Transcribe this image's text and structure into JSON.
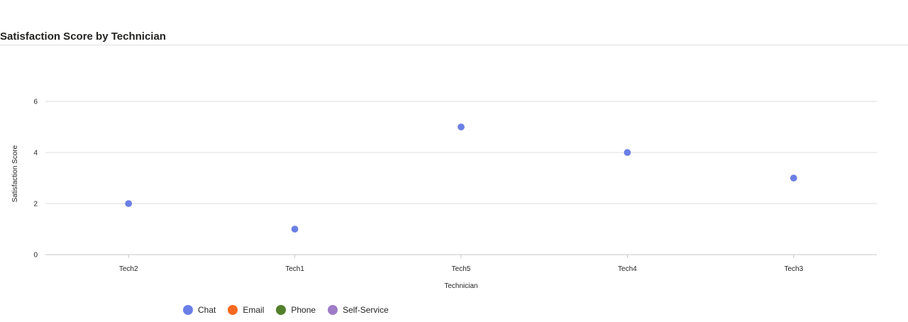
{
  "title": "Satisfaction Score by Technician",
  "chart_data": {
    "type": "scatter",
    "title": "Satisfaction Score by Technician",
    "xlabel": "Technician",
    "ylabel": "Satisfaction Score",
    "categories": [
      "Tech2",
      "Tech1",
      "Tech5",
      "Tech4",
      "Tech3"
    ],
    "ylim": [
      0,
      6
    ],
    "yticks": [
      0,
      2,
      4,
      6
    ],
    "grid": true,
    "legend_position": "bottom-left",
    "series": [
      {
        "name": "Chat",
        "color": "#6B7FE8",
        "values": [
          2,
          1,
          5,
          4,
          3
        ]
      },
      {
        "name": "Email",
        "color": "#F7691E",
        "values": []
      },
      {
        "name": "Phone",
        "color": "#53802C",
        "values": []
      },
      {
        "name": "Self-Service",
        "color": "#9E7CC6",
        "values": []
      }
    ]
  }
}
